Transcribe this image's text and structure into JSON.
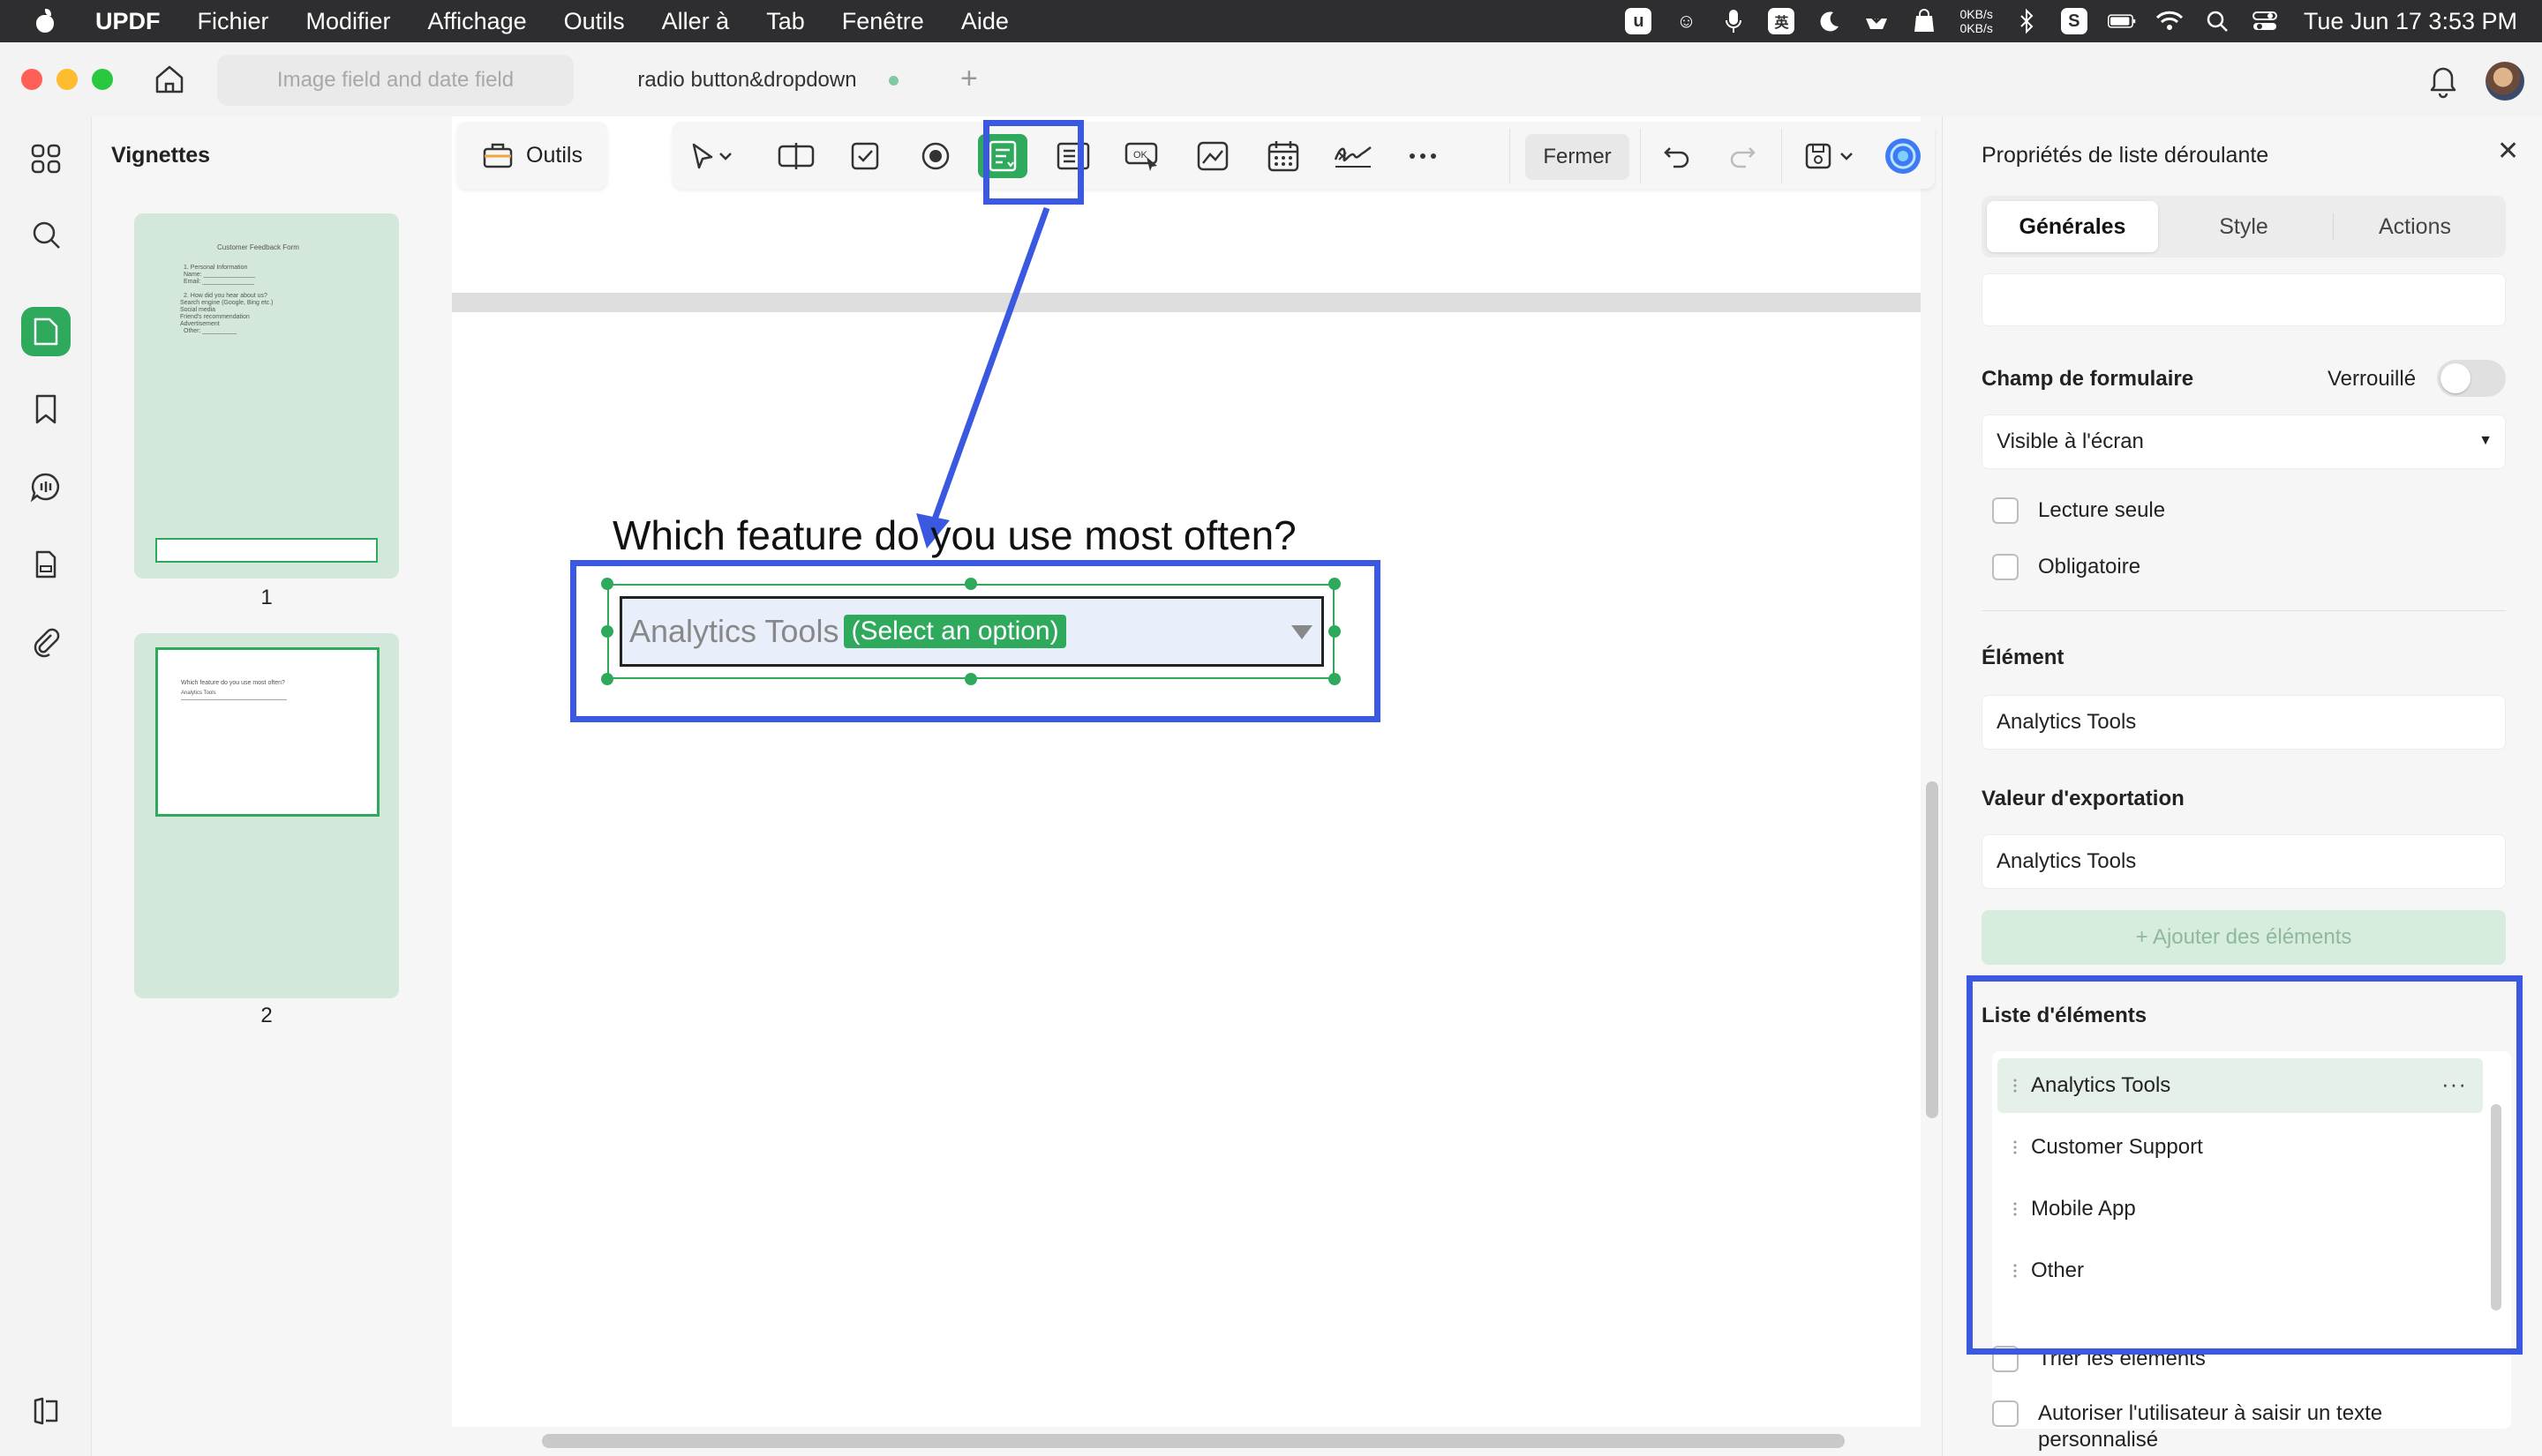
{
  "menubar": {
    "app_name": "UPDF",
    "items": [
      "Fichier",
      "Modifier",
      "Affichage",
      "Outils",
      "Aller à",
      "Tab",
      "Fenêtre",
      "Aide"
    ],
    "net_up": "0KB/s",
    "net_down": "0KB/s",
    "clock": "Tue Jun 17  3:53 PM"
  },
  "titlebar": {
    "tabs": [
      {
        "label": "Image field and date field"
      },
      {
        "label": "radio button&dropdown"
      }
    ],
    "add_tab": "+"
  },
  "thumbnails": {
    "title": "Vignettes",
    "page1": {
      "number": "1",
      "mini_lines": [
        "Customer Feedback Form",
        "1. Personal Information",
        "Name: _______________",
        "Email: _______________",
        "2. How did you hear about us?",
        "Search engine (Google, Bing etc.)",
        "Social media",
        "Friend's recommendation",
        "Advertisement",
        "Other: __________"
      ]
    },
    "page2": {
      "number": "2",
      "mini_lines": [
        "Which feature do you use most often?",
        "Analytics Tools"
      ]
    }
  },
  "toolbar": {
    "outils_label": "Outils",
    "fermer_label": "Fermer"
  },
  "document": {
    "question": "Which feature do you use most often?",
    "dropdown_value": "Analytics Tools",
    "dropdown_badge": "(Select an option)"
  },
  "properties": {
    "title": "Propriétés de liste déroulante",
    "tabs": [
      "Générales",
      "Style",
      "Actions"
    ],
    "form_field_label": "Champ de formulaire",
    "locked_label": "Verrouillé",
    "visibility_value": "Visible à l'écran",
    "readonly_label": "Lecture seule",
    "required_label": "Obligatoire",
    "element_label": "Élément",
    "element_value": "Analytics Tools",
    "export_label": "Valeur d'exportation",
    "export_value": "Analytics Tools",
    "add_elements_label": "+ Ajouter des éléments",
    "list_label": "Liste d'éléments",
    "list_items": [
      "Analytics Tools",
      "Customer Support",
      "Mobile App",
      "Other"
    ],
    "sort_label": "Trier les éléments",
    "custom_text_label": "Autoriser l'utilisateur à saisir un texte personnalisé"
  },
  "colors": {
    "accent": "#2faa5c",
    "annotation": "#3a58e0"
  }
}
